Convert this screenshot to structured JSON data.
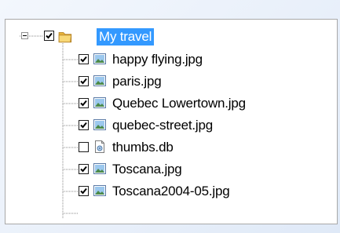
{
  "tree": {
    "root": {
      "label": "My travel",
      "checked": true,
      "expanded": true,
      "selected": true,
      "icon": "folder-icon"
    },
    "items": [
      {
        "label": "happy flying.jpg",
        "checked": true,
        "icon": "image-file-icon"
      },
      {
        "label": "paris.jpg",
        "checked": true,
        "icon": "image-file-icon"
      },
      {
        "label": "Quebec Lowertown.jpg",
        "checked": true,
        "icon": "image-file-icon"
      },
      {
        "label": "quebec-street.jpg",
        "checked": true,
        "icon": "image-file-icon"
      },
      {
        "label": "thumbs.db",
        "checked": false,
        "icon": "system-file-icon"
      },
      {
        "label": "Toscana.jpg",
        "checked": true,
        "icon": "image-file-icon"
      },
      {
        "label": "Toscana2004-05.jpg",
        "checked": true,
        "icon": "image-file-icon"
      }
    ]
  },
  "colors": {
    "selection": "#3399ff",
    "folder": "#f2c349",
    "tree_line": "#8a8a8a"
  }
}
